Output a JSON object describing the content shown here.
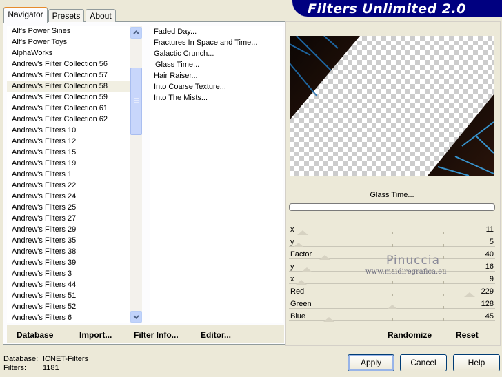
{
  "app_title": "Filters Unlimited 2.0",
  "tabs": [
    {
      "label": "Navigator"
    },
    {
      "label": "Presets"
    },
    {
      "label": "About"
    }
  ],
  "categories": [
    "Alf's Power Sines",
    "Alf's Power Toys",
    "AlphaWorks",
    "Andrew's Filter Collection 56",
    "Andrew's Filter Collection 57",
    "Andrew's Filter Collection 58",
    "Andrew's Filter Collection 59",
    "Andrew's Filter Collection 61",
    "Andrew's Filter Collection 62",
    "Andrew's Filters 10",
    "Andrew's Filters 12",
    "Andrew's Filters 15",
    "Andrew's Filters 19",
    "Andrew's Filters 1",
    "Andrew's Filters 22",
    "Andrew's Filters 24",
    "Andrew's Filters 25",
    "Andrew's Filters 27",
    "Andrew's Filters 29",
    "Andrew's Filters 35",
    "Andrew's Filters 38",
    "Andrew's Filters 39",
    "Andrew's Filters 3",
    "Andrew's Filters 44",
    "Andrew's Filters 51",
    "Andrew's Filters 52",
    "Andrew's Filters 6"
  ],
  "selected_category_index": 5,
  "filters": [
    "Faded Day...",
    "Fractures In Space and Time...",
    "Galactic Crunch...",
    "Glass Time...",
    "Hair Raiser...",
    "Into Coarse Texture...",
    "Into The Mists..."
  ],
  "selected_filter_index": 3,
  "bottom_buttons": {
    "database": "Database",
    "import": "Import...",
    "filter_info": "Filter Info...",
    "editor": "Editor..."
  },
  "filter_name": "Glass Time...",
  "sliders": [
    {
      "label": "x",
      "value": "11",
      "level": 0.043
    },
    {
      "label": "y",
      "value": "5",
      "level": 0.02
    },
    {
      "label": "Factor",
      "value": "40",
      "level": 0.157
    },
    {
      "label": "y",
      "value": "16",
      "level": 0.063
    },
    {
      "label": "x",
      "value": "9",
      "level": 0.035
    },
    {
      "label": "Red",
      "value": "229",
      "level": 0.898
    },
    {
      "label": "Green",
      "value": "128",
      "level": 0.502
    },
    {
      "label": "Blue",
      "value": "45",
      "level": 0.176
    }
  ],
  "watermark": {
    "name": "Pinuccia",
    "site": "www.maidiregrafica.eu"
  },
  "randomize_label": "Randomize",
  "reset_label": "Reset",
  "status": {
    "database_label": "Database:",
    "database_value": "ICNET-Filters",
    "filters_label": "Filters:",
    "filters_value": "1181"
  },
  "buttons": {
    "apply": "Apply",
    "cancel": "Cancel",
    "help": "Help"
  },
  "colors": {
    "banner": "#000080",
    "selection": "#316ac5",
    "tab_accent": "#e68b2c"
  }
}
